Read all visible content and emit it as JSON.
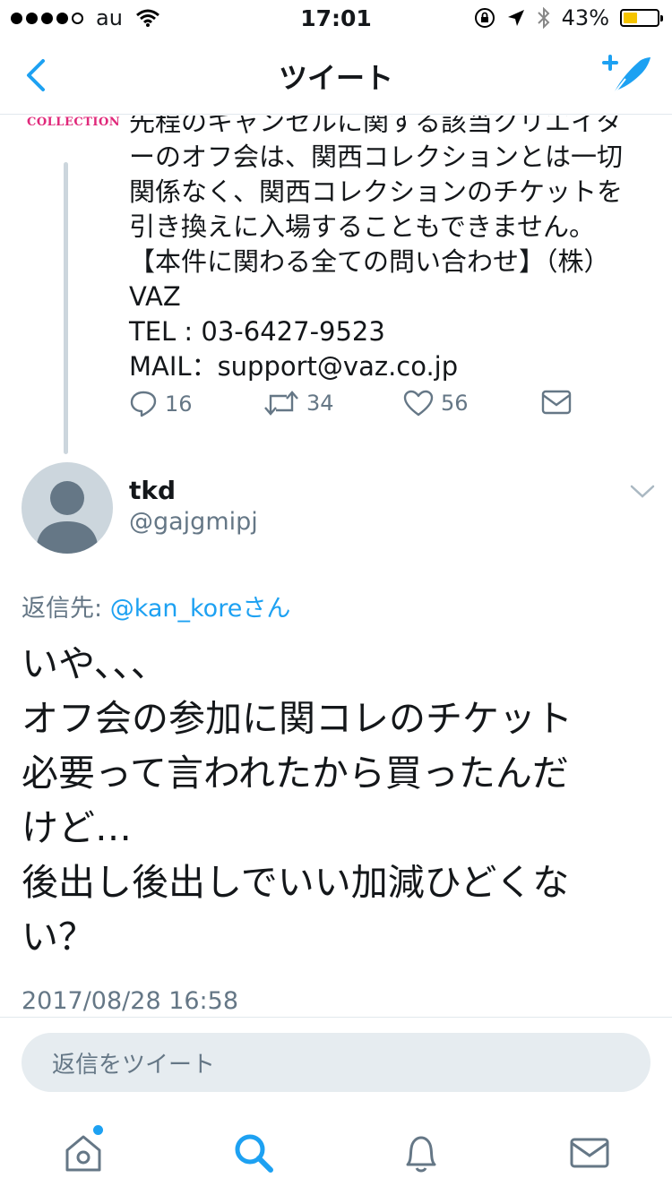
{
  "status_bar": {
    "carrier": "au",
    "time": "17:01",
    "battery": "43%",
    "battery_level": 0.43,
    "colors": {
      "battery_fill": "#f5c400"
    }
  },
  "nav": {
    "title": "ツイート",
    "back_icon": "chevron-left-icon",
    "compose_icon": "compose-tweet-icon"
  },
  "previous_tweet": {
    "logo_text": "COLLECTION",
    "text_lines": [
      "先程のキャンセルに関する該当クリエイタ",
      "ーのオフ会は、関西コレクションとは一切",
      "関係なく、関西コレクションのチケットを",
      "引き換えに入場することもできません。",
      "【本件に関わる全ての問い合わせ】（株）",
      "VAZ",
      "TEL : 03-6427-9523",
      "MAIL：support@vaz.co.jp"
    ],
    "actions": {
      "replies": "16",
      "retweets": "34",
      "likes": "56"
    }
  },
  "tweet": {
    "user_name": "tkd",
    "user_handle": "@gajgmipj",
    "reply_prefix": "返信先: ",
    "reply_mention": "@kan_koreさん",
    "text_lines": [
      "いや、、、",
      "オフ会の参加に関コレのチケット",
      "必要って言われたから買ったんだ",
      "けど…",
      "後出し後出しでいい加減ひどくな",
      "い？"
    ],
    "timestamp": "2017/08/28 16:58"
  },
  "reply_bar": {
    "placeholder": "返信をツイート"
  },
  "tab_bar": {
    "tabs": [
      "home-icon",
      "search-icon",
      "notifications-icon",
      "messages-icon"
    ],
    "active_tab": "search-icon"
  },
  "colors": {
    "accent": "#1da1f2",
    "secondary_text": "#657786",
    "border": "#e1e8ed",
    "input_bg": "#e6ecf0"
  }
}
